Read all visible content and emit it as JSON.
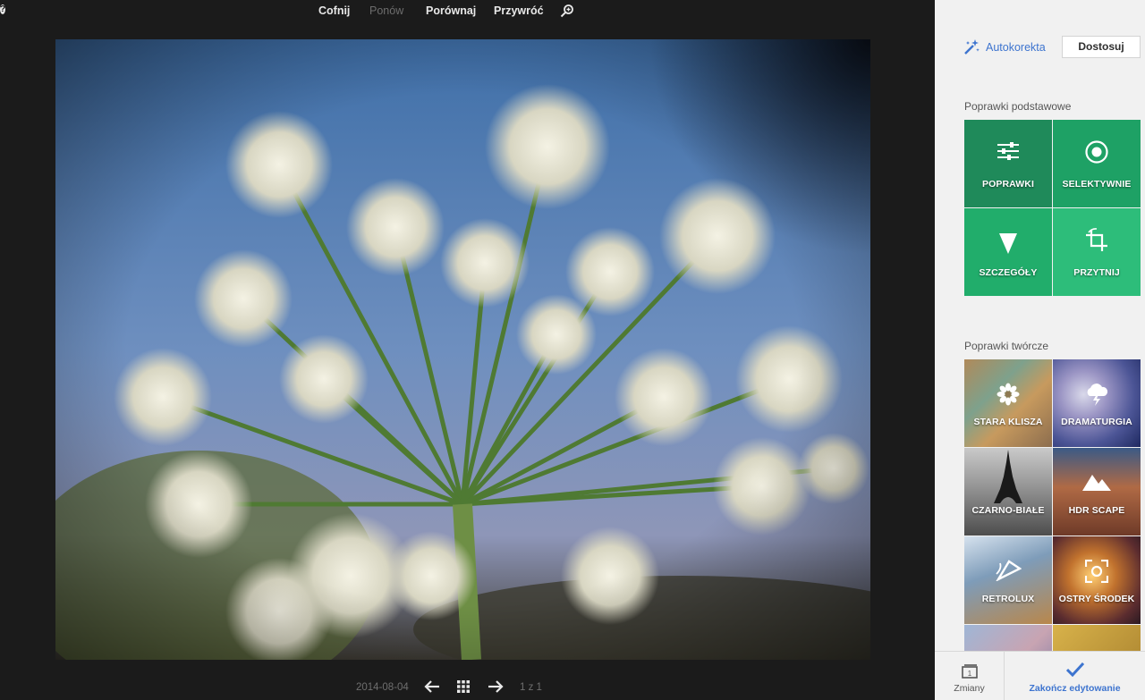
{
  "toolbar": {
    "undo": "Cofnij",
    "redo": "Ponów",
    "compare": "Porównaj",
    "reset": "Przywróć",
    "zoom_icon": "zoom-icon",
    "help_icon": "help-icon",
    "help_glyph": "?"
  },
  "photo": {
    "subject": "wild-carrot-flower-photo"
  },
  "bottom_bar": {
    "date": "2014-08-04",
    "prev_icon": "arrow-left-icon",
    "grid_icon": "grid-icon",
    "next_icon": "arrow-right-icon",
    "page_count": "1 z 1"
  },
  "panel": {
    "auto_label": "Autokorekta",
    "adjust_label": "Dostosuj",
    "basic_title": "Poprawki podstawowe",
    "basic_tiles": [
      {
        "label": "POPRAWKI",
        "icon": "sliders-icon"
      },
      {
        "label": "SELEKTYWNIE",
        "icon": "target-icon"
      },
      {
        "label": "SZCZEGÓŁY",
        "icon": "triangle-icon"
      },
      {
        "label": "PRZYTNIJ",
        "icon": "crop-rotate-icon"
      }
    ],
    "creative_title": "Poprawki twórcze",
    "creative_tiles": [
      {
        "label": "STARA KLISZA",
        "icon": "flower-icon"
      },
      {
        "label": "DRAMATURGIA",
        "icon": "storm-cloud-icon"
      },
      {
        "label": "CZARNO-BIAŁE",
        "icon": "eiffel-tower-icon"
      },
      {
        "label": "HDR SCAPE",
        "icon": "mountains-icon"
      },
      {
        "label": "RETROLUX",
        "icon": "light-leak-icon"
      },
      {
        "label": "OSTRY ŚRODEK",
        "icon": "focus-frame-icon"
      }
    ],
    "footer": {
      "changes_label": "Zmiany",
      "finish_label": "Zakończ edytowanie"
    }
  },
  "colors": {
    "accent_blue": "#3d74cf",
    "green_dark": "#1f8a5a",
    "green_light": "#2dbd7a",
    "background_dark": "#1b1b1b",
    "panel_bg": "#f1f1f1"
  }
}
